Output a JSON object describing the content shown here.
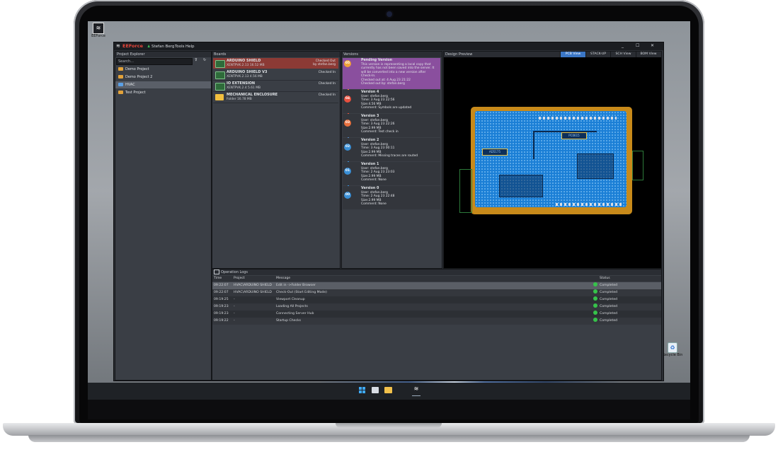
{
  "desktop": {
    "top_icon_label": "EEForce",
    "recycle_label": "Recycle Bin"
  },
  "app": {
    "logo_text": "EEForce",
    "user_label": "Stefan Berg",
    "menu": [
      "Tools",
      "Help"
    ],
    "window_controls": {
      "minimize": "_",
      "maximize": "☐",
      "close": "✕"
    }
  },
  "project_explorer": {
    "title": "Project Explorer",
    "search_placeholder": "Search...",
    "projects": [
      {
        "name": "Demo Project",
        "icon": "folder-icon",
        "selected": false
      },
      {
        "name": "Demo Project 2",
        "icon": "folder-icon",
        "selected": false
      },
      {
        "name": "HVAC",
        "icon": "folder-icon",
        "selected": true
      },
      {
        "name": "Test Project",
        "icon": "folder-icon",
        "selected": false
      }
    ]
  },
  "boards": {
    "title": "Boards",
    "items": [
      {
        "name": "ARDUINO SHIELD",
        "sub": "XENTPVK.2.13 16.52 MB",
        "status": "Checked Out\nby stefan.berg",
        "type": "board",
        "highlight": true
      },
      {
        "name": "ARDUINO SHIELD V3",
        "sub": "XENTPVK.2.13 4.56 MB",
        "status": "Checked In",
        "type": "board",
        "highlight": false
      },
      {
        "name": "IO EXTENSION",
        "sub": "XENTPVK.2.4 5.61 MB",
        "status": "Checked In",
        "type": "board",
        "highlight": false
      },
      {
        "name": "MECHANICAL ENCLOSURE",
        "sub": "Folder 16.78 MB",
        "status": "Checked In",
        "type": "folder",
        "highlight": false
      }
    ]
  },
  "versions": {
    "title": "Versions",
    "items": [
      {
        "badge": "05",
        "color": "#f0a23a",
        "title": "Pending Version",
        "body": "This version is representing a local copy that\ncurrently has not been saved into the server. It\nwill be converted into a new version after\nCheck-In.\nChecked out at: 4 Aug 23 21:22\nChecked out by: stefan.berg",
        "pending": true
      },
      {
        "badge": "04",
        "color": "#e8503e",
        "title": "Version 4",
        "body": "User: stefan.berg\nTime: 3 Aug 23 22:56\nSize:4.56 MB\nComment: Symbols are updated",
        "pending": false
      },
      {
        "badge": "03",
        "color": "#e8703e",
        "title": "Version 3",
        "body": "User: stefan.berg\nTime: 3 Aug 23 22:26\nSize:2.99 MB\nComment: Test check in",
        "pending": false
      },
      {
        "badge": "02",
        "color": "#3a8fd6",
        "title": "Version 2",
        "body": "User: stefan.berg\nTime: 3 Aug 23 00:11\nSize:2.99 MB\nComment: Missing traces are routed",
        "pending": false
      },
      {
        "badge": "01",
        "color": "#3a8fd6",
        "title": "Version 1",
        "body": "User: stefan.berg\nTime: 2 Aug 23 23:03\nSize:2.99 MB\nComment: None",
        "pending": false
      },
      {
        "badge": "00",
        "color": "#3a8fd6",
        "title": "Version 0",
        "body": "User: stefan.berg\nTime: 2 Aug 23 22:48\nSize:2.99 MB\nComment: None",
        "pending": false
      }
    ]
  },
  "design_preview": {
    "title": "Design Preview",
    "tabs": [
      {
        "label": "PCB View",
        "active": true
      },
      {
        "label": "STACK-UP",
        "active": false
      },
      {
        "label": "SCH View",
        "active": false
      },
      {
        "label": "BOM View",
        "active": false
      }
    ],
    "pcb_labels": [
      "AD5175",
      "PC0615"
    ]
  },
  "logs": {
    "title": "Operation Logs",
    "columns": [
      "Time",
      "Project",
      "Message",
      "Status"
    ],
    "rows": [
      {
        "time": "09:22:07",
        "project": "HVAC\\ARDUINO SHIELD",
        "message": "Edit in ->Folder Browser",
        "status": "Completed",
        "selected": true
      },
      {
        "time": "09:22:07",
        "project": "HVAC\\ARDUINO SHIELD",
        "message": "Check-Out (Start Editing Mode)",
        "status": "Completed",
        "selected": false
      },
      {
        "time": "09:19:25",
        "project": "-",
        "message": "Viewport Cleanup",
        "status": "Completed",
        "selected": false
      },
      {
        "time": "09:19:23",
        "project": "-",
        "message": "Loading All Projects",
        "status": "Completed",
        "selected": false
      },
      {
        "time": "09:19:23",
        "project": "-",
        "message": "Connecting Server Hub",
        "status": "Completed",
        "selected": false
      },
      {
        "time": "09:19:22",
        "project": "-",
        "message": "Startup Checks",
        "status": "Completed",
        "selected": false
      }
    ]
  }
}
